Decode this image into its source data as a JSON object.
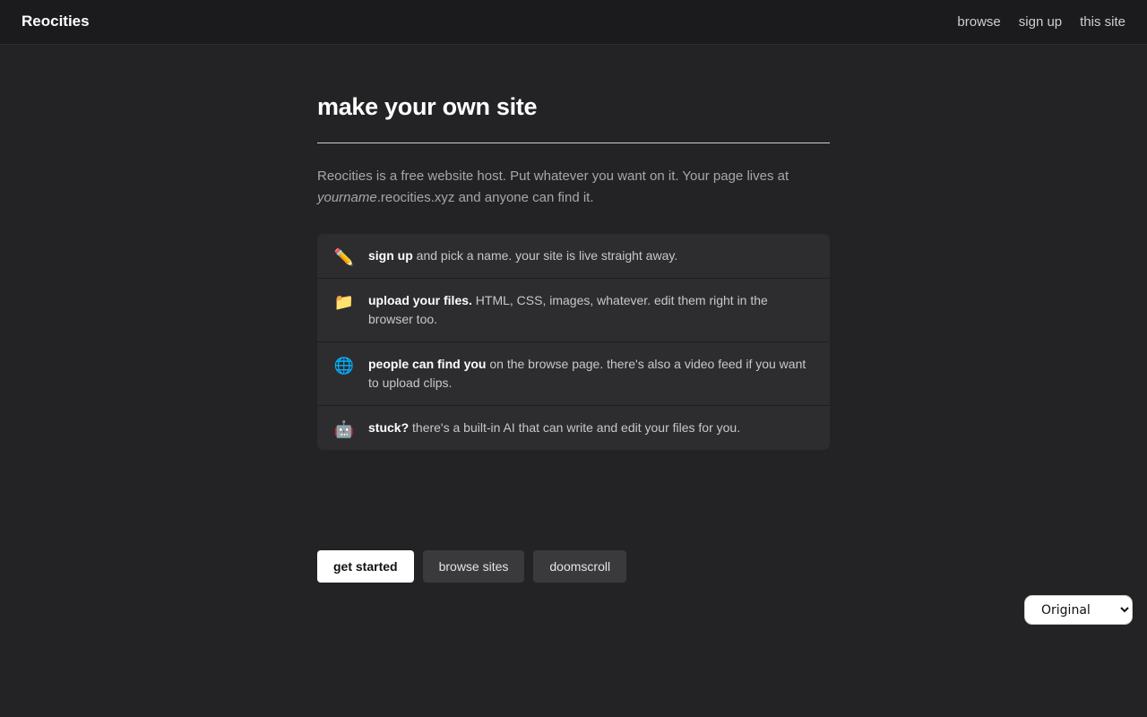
{
  "header": {
    "brand": "Reocities",
    "nav": [
      "browse",
      "sign up",
      "this site"
    ]
  },
  "main": {
    "title": "make your own site",
    "intro": {
      "lead": "Reocities is a free website host. Put whatever you want on it. Your page lives at",
      "name": "yourname",
      "domain": ".reocities.xyz",
      "tail": " and anyone can find it."
    },
    "features": [
      {
        "icon": "✏️",
        "icon_name": "pencil-icon",
        "bold": "sign up",
        "text": " and pick a name. your site is live straight away."
      },
      {
        "icon": "📁",
        "icon_name": "folder-icon",
        "bold": "upload your files.",
        "text": " HTML, CSS, images, whatever. edit them right in the browser too."
      },
      {
        "icon": "🌐",
        "icon_name": "globe-icon",
        "bold": "people can find you",
        "text": " on the browse page. there's also a video feed if you want to upload clips."
      },
      {
        "icon": "🤖",
        "icon_name": "robot-icon",
        "bold": "stuck?",
        "text": " there's a built-in AI that can write and edit your files for you."
      }
    ],
    "buttons": {
      "get_started": "get started",
      "browse_sites": "browse sites",
      "doomscroll": "doomscroll"
    }
  },
  "style_select": {
    "selected": "Original"
  },
  "colors": {
    "background": "#232325",
    "header": "#1b1b1d",
    "card": "#2d2d30",
    "primary_button": "#ffffff",
    "secondary_button": "#3a3a3d"
  }
}
